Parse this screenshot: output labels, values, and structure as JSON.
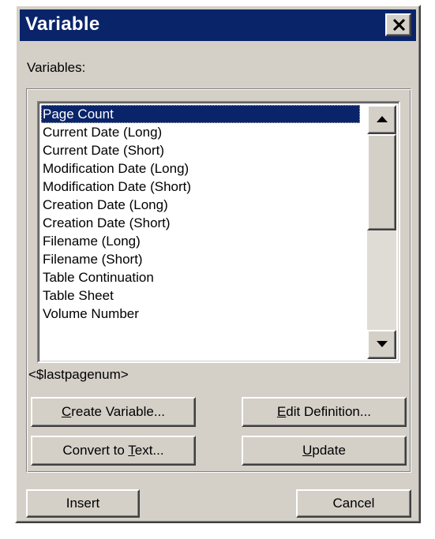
{
  "dialog": {
    "title": "Variable",
    "variables_label": "Variables:",
    "selected_definition": "<$lastpagenum>"
  },
  "variables": {
    "items": [
      {
        "label": "Page Count",
        "selected": true
      },
      {
        "label": "Current Date (Long)",
        "selected": false
      },
      {
        "label": "Current Date (Short)",
        "selected": false
      },
      {
        "label": "Modification Date (Long)",
        "selected": false
      },
      {
        "label": "Modification Date (Short)",
        "selected": false
      },
      {
        "label": "Creation Date (Long)",
        "selected": false
      },
      {
        "label": "Creation Date (Short)",
        "selected": false
      },
      {
        "label": "Filename (Long)",
        "selected": false
      },
      {
        "label": "Filename (Short)",
        "selected": false
      },
      {
        "label": "Table Continuation",
        "selected": false
      },
      {
        "label": "Table Sheet",
        "selected": false
      },
      {
        "label": "Volume Number",
        "selected": false
      }
    ]
  },
  "buttons": {
    "create_variable": {
      "pre": "",
      "mnemonic": "C",
      "post": "reate Variable..."
    },
    "edit_definition": {
      "pre": "",
      "mnemonic": "E",
      "post": "dit Definition..."
    },
    "convert_to_text": {
      "pre": "Convert to ",
      "mnemonic": "T",
      "post": "ext..."
    },
    "update": {
      "pre": "",
      "mnemonic": "U",
      "post": "pdate"
    },
    "insert": "Insert",
    "cancel": "Cancel"
  },
  "icons": {
    "close": "close-icon",
    "scroll_up": "arrow-up-icon",
    "scroll_down": "arrow-down-icon"
  },
  "colors": {
    "title_bar": "#0a246a",
    "selection": "#0a246a",
    "face": "#d4d0c8"
  }
}
